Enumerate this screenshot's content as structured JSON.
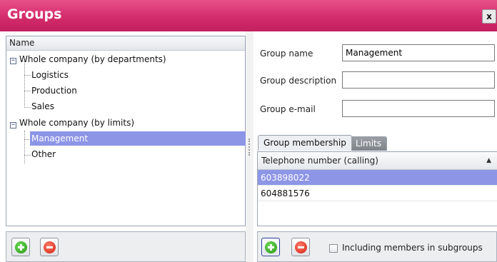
{
  "window": {
    "title": "Groups",
    "close_label": "x"
  },
  "tree": {
    "header": "Name",
    "items": [
      {
        "label": "Whole company (by departments)",
        "expanded": true
      },
      {
        "label": "Logistics"
      },
      {
        "label": "Production"
      },
      {
        "label": "Sales"
      },
      {
        "label": "Whole company (by limits)",
        "expanded": true
      },
      {
        "label": "Management",
        "selected": true
      },
      {
        "label": "Other"
      }
    ],
    "expander_symbol": "−"
  },
  "form": {
    "group_name_label": "Group name",
    "group_name_value": "Management",
    "group_description_label": "Group description",
    "group_description_value": "",
    "group_email_label": "Group e-mail",
    "group_email_value": ""
  },
  "tabs": {
    "membership_label": "Group membership",
    "limits_label": "Limits",
    "active": "Group membership"
  },
  "grid": {
    "column_header": "Telephone number (calling)",
    "sort_icon": "▲",
    "rows": [
      {
        "value": "603898022",
        "selected": true
      },
      {
        "value": "604881576"
      }
    ]
  },
  "bottom": {
    "include_subgroups_label": "Including members in subgroups",
    "include_subgroups_checked": false
  },
  "icons": {
    "add": "add-icon",
    "remove": "remove-icon",
    "close": "close-icon",
    "expand": "expander-minus-icon"
  },
  "colors": {
    "titlebar": "#d42c6c",
    "selection": "#8d95e6",
    "add_green": "#23940f",
    "remove_red": "#d0210f"
  }
}
